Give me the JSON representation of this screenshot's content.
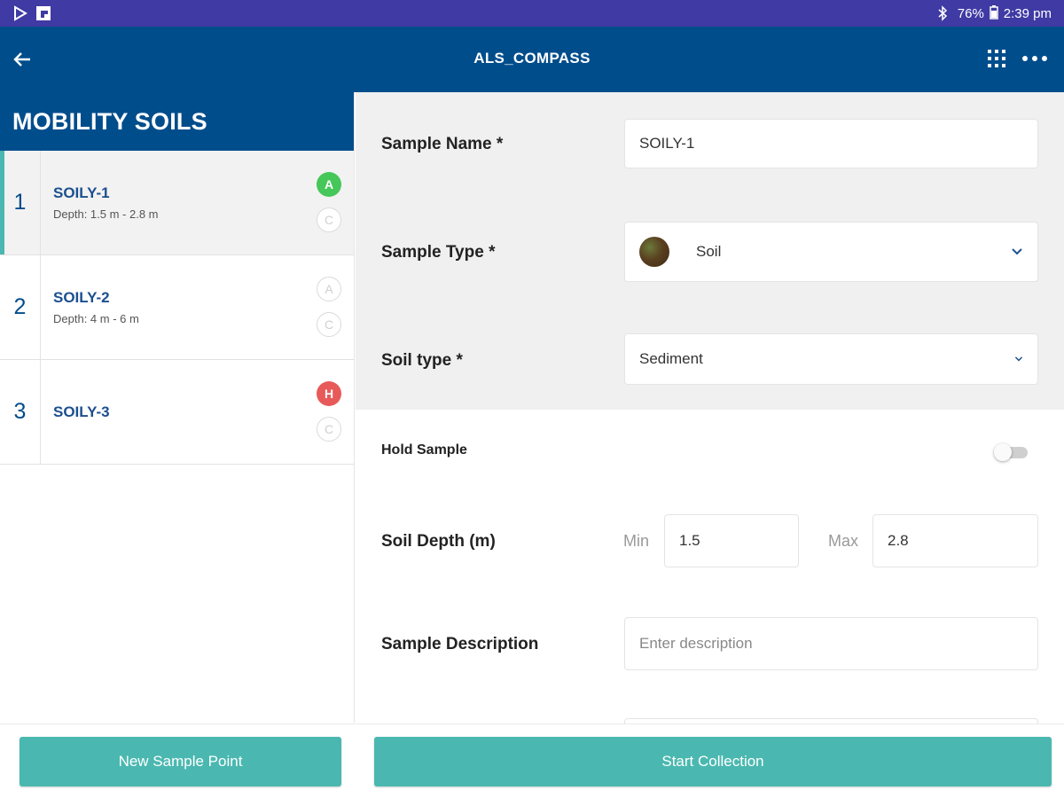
{
  "status_bar": {
    "battery": "76%",
    "time": "2:39 pm",
    "icons": [
      "play-store-icon",
      "flipboard-icon",
      "bluetooth-icon",
      "battery-icon"
    ]
  },
  "app_bar": {
    "title": "ALS_COMPASS",
    "icons": [
      "back-arrow-icon",
      "apps-grid-icon",
      "more-options-icon"
    ]
  },
  "sidebar": {
    "header": "MOBILITY SOILS",
    "items": [
      {
        "number": "1",
        "name": "SOILY-1",
        "depth": "Depth: 1.5 m - 2.8 m",
        "badge_top": "A",
        "badge_bottom": "C"
      },
      {
        "number": "2",
        "name": "SOILY-2",
        "depth": "Depth: 4 m - 6 m",
        "badge_top": "A",
        "badge_bottom": "C"
      },
      {
        "number": "3",
        "name": "SOILY-3",
        "depth": "",
        "badge_top": "H",
        "badge_bottom": "C"
      }
    ],
    "new_button": "New Sample Point"
  },
  "form": {
    "sample_name_label": "Sample Name *",
    "sample_name_value": "SOILY-1",
    "sample_type_label": "Sample Type *",
    "sample_type_value": "Soil",
    "soil_type_label": "Soil type *",
    "soil_type_value": "Sediment",
    "hold_sample_label": "Hold Sample",
    "hold_sample_on": false,
    "soil_depth_label": "Soil Depth (m)",
    "min_label": "Min",
    "min_value": "1.5",
    "max_label": "Max",
    "max_value": "2.8",
    "description_label": "Sample Description",
    "description_placeholder": "Enter description",
    "start_button": "Start Collection"
  },
  "colors": {
    "status_bar": "#3f3aa4",
    "app_bar": "#004d8c",
    "accent_teal": "#4ab8b0",
    "badge_green": "#46c759",
    "badge_red": "#e85a5a"
  }
}
